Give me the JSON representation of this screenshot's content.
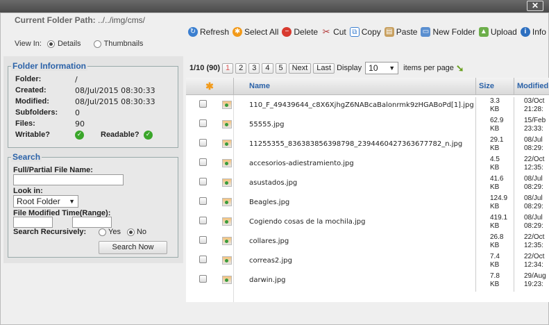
{
  "window": {
    "close_label": "✕"
  },
  "path": {
    "label": "Current Folder Path:",
    "value": "../../img/cms/"
  },
  "view_in": {
    "label": "View In:",
    "details": "Details",
    "thumbnails": "Thumbnails",
    "selected": "Details"
  },
  "toolbar": {
    "refresh": "Refresh",
    "select_all": "Select All",
    "delete": "Delete",
    "cut": "Cut",
    "copy": "Copy",
    "paste": "Paste",
    "new_folder": "New Folder",
    "upload": "Upload",
    "info": "Info"
  },
  "folder_info": {
    "title": "Folder Information",
    "folder_label": "Folder:",
    "folder": "/",
    "created_label": "Created:",
    "created": "08/Jul/2015 08:30:33",
    "modified_label": "Modified:",
    "modified": "08/Jul/2015 08:30:33",
    "subfolders_label": "Subfolders:",
    "subfolders": "0",
    "files_label": "Files:",
    "files": "90",
    "writable_label": "Writable?",
    "readable_label": "Readable?"
  },
  "search": {
    "title": "Search",
    "name_label": "Full/Partial File Name:",
    "name_value": "",
    "look_in_label": "Look in:",
    "look_in_value": "Root Folder",
    "modified_label": "File Modified Time(Range):",
    "recursive_label": "Search Recursively:",
    "yes": "Yes",
    "no": "No",
    "button": "Search Now"
  },
  "pager": {
    "status": "1/10 (90)",
    "pages": [
      "1",
      "2",
      "3",
      "4",
      "5"
    ],
    "next": "Next",
    "last": "Last",
    "display_label": "Display",
    "per_page": "10",
    "per_page_label": "items per page"
  },
  "grid": {
    "headers": {
      "name": "Name",
      "size": "Size",
      "modified": "Modified"
    },
    "rows": [
      {
        "name": "110_F_49439644_c8X6XjhgZ6NABcaBalonrmk9zHGABoPd[1].jpg",
        "size": "3.3",
        "unit": "KB",
        "mod1": "03/Oct",
        "mod2": "21:28:"
      },
      {
        "name": "55555.jpg",
        "size": "62.9",
        "unit": "KB",
        "mod1": "15/Feb",
        "mod2": "23:33:"
      },
      {
        "name": "11255355_836383856398798_2394460427363677782_n.jpg",
        "size": "29.1",
        "unit": "KB",
        "mod1": "08/Jul",
        "mod2": "08:29:"
      },
      {
        "name": "accesorios-adiestramiento.jpg",
        "size": "4.5",
        "unit": "KB",
        "mod1": "22/Oct",
        "mod2": "12:35:"
      },
      {
        "name": "asustados.jpg",
        "size": "41.6",
        "unit": "KB",
        "mod1": "08/Jul",
        "mod2": "08:29:"
      },
      {
        "name": "Beagles.jpg",
        "size": "124.9",
        "unit": "KB",
        "mod1": "08/Jul",
        "mod2": "08:29:"
      },
      {
        "name": "Cogiendo cosas de la mochila.jpg",
        "size": "419.1",
        "unit": "KB",
        "mod1": "08/Jul",
        "mod2": "08:29:"
      },
      {
        "name": "collares.jpg",
        "size": "26.8",
        "unit": "KB",
        "mod1": "22/Oct",
        "mod2": "12:35:"
      },
      {
        "name": "correas2.jpg",
        "size": "7.4",
        "unit": "KB",
        "mod1": "22/Oct",
        "mod2": "12:34:"
      },
      {
        "name": "darwin.jpg",
        "size": "7.8",
        "unit": "KB",
        "mod1": "29/Aug",
        "mod2": "19:23:"
      }
    ]
  }
}
